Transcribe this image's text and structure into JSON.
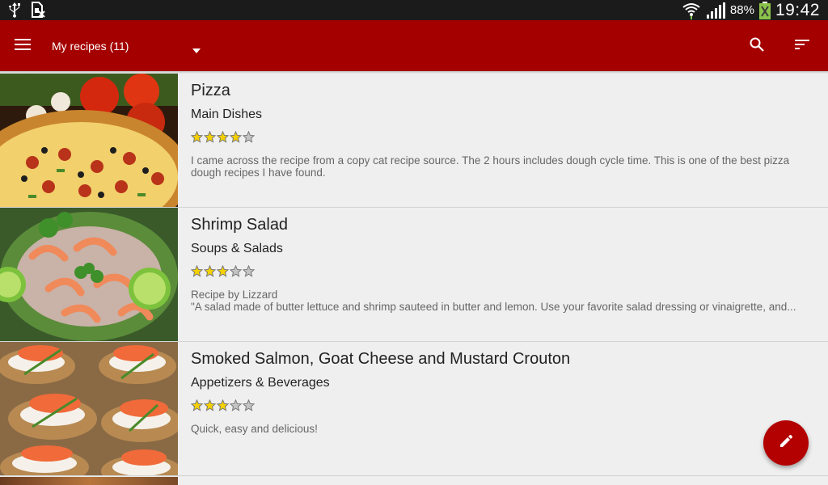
{
  "status_bar": {
    "icons_left": [
      "usb-icon",
      "sim-card-off-icon"
    ],
    "battery_percent": "88%",
    "time": "19:42"
  },
  "app_bar": {
    "title": "My recipes (11)",
    "background": "#a50000",
    "icons": [
      "menu-icon",
      "search-icon",
      "sort-icon"
    ]
  },
  "recipes": [
    {
      "title": "Pizza",
      "category": "Main Dishes",
      "rating": 4,
      "rating_max": 5,
      "description_lines": [
        "I came across the recipe from a copy cat recipe source. The 2 hours includes dough cycle time. This is one of the best pizza",
        "dough recipes I have found."
      ]
    },
    {
      "title": "Shrimp Salad",
      "category": "Soups & Salads",
      "rating": 3,
      "rating_max": 5,
      "description_lines": [
        "Recipe by Lizzard",
        "\"A salad made of butter lettuce and shrimp sauteed in butter and lemon. Use your favorite salad dressing or vinaigrette, and..."
      ]
    },
    {
      "title": "Smoked Salmon, Goat Cheese and Mustard Crouton",
      "category": "Appetizers & Beverages",
      "rating": 3,
      "rating_max": 5,
      "description_lines": [
        "Quick, easy and delicious!"
      ]
    }
  ],
  "fab": {
    "icon": "edit-pencil-icon",
    "color": "#b30000"
  }
}
